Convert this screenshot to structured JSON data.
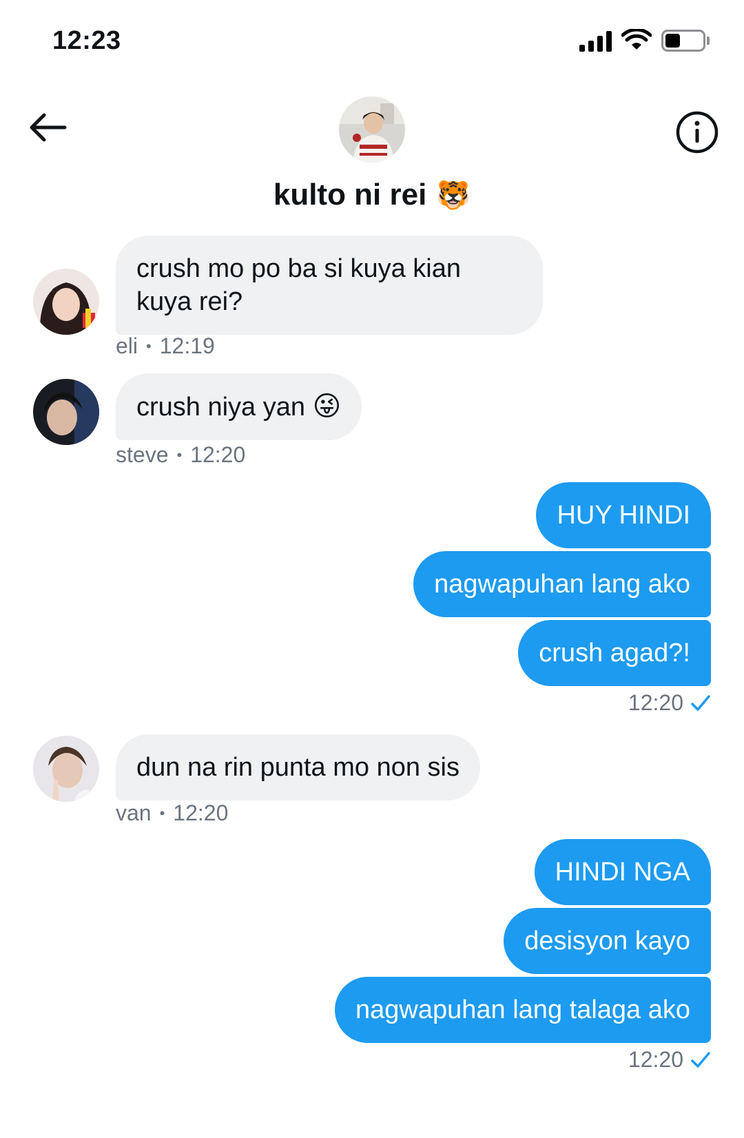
{
  "status_bar": {
    "time": "12:23",
    "battery_level": 0.4
  },
  "header": {
    "title": "kulto ni rei",
    "title_emoji": "🐯",
    "back_icon": "arrow-left-icon",
    "info_icon": "info-circle-icon"
  },
  "messages": [
    {
      "text_line1": "crush mo po ba si kuya kian",
      "text_line2": "kuya rei?",
      "author": "eli",
      "time": "12:19"
    },
    {
      "text": "crush niya yan",
      "emoji": "😜",
      "author": "steve",
      "time": "12:20"
    },
    {
      "out_group1": [
        "HUY HINDI",
        "nagwapuhan lang ako",
        "crush agad?!"
      ],
      "time": "12:20"
    },
    {
      "text": "dun na rin punta mo non sis",
      "author": "van",
      "time": "12:20"
    },
    {
      "out_group2": [
        "HINDI NGA",
        "desisyon kayo",
        "nagwapuhan lang talaga ako"
      ],
      "time": "12:20"
    }
  ],
  "dot": "•",
  "colors": {
    "outgoing": "#1d9bf0",
    "incoming": "#eff1f3",
    "check": "#1d9bf0"
  }
}
